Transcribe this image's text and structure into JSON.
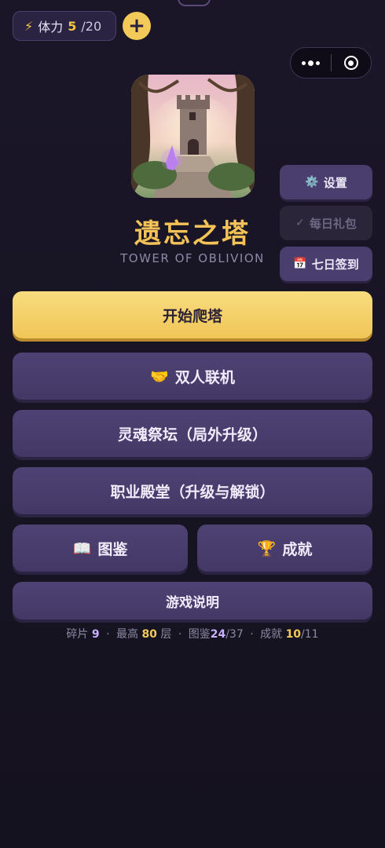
{
  "stamina": {
    "icon": "⚡",
    "label": "体力",
    "current": "5",
    "max": "/20"
  },
  "add_button": {
    "label": "+"
  },
  "game": {
    "title": "遗忘之塔",
    "subtitle": "TOWER OF OBLIVION"
  },
  "side_menu": {
    "settings": {
      "icon": "⚙️",
      "label": "设置"
    },
    "daily_gift": {
      "icon": "✓",
      "label": "每日礼包"
    },
    "seven_day": {
      "icon": "📅",
      "label": "七日签到"
    }
  },
  "main_menu": {
    "start": "开始爬塔",
    "coop": {
      "icon": "🤝",
      "label": "双人联机"
    },
    "altar": "灵魂祭坛（局外升级）",
    "hall": "职业殿堂（升级与解锁）",
    "codex": {
      "icon": "📖",
      "label": "图鉴"
    },
    "achievements": {
      "icon": "🏆",
      "label": "成就"
    },
    "guide": "游戏说明"
  },
  "stats": {
    "shards_label": "碎片",
    "shards": "9",
    "best_label": "最高",
    "best": "80",
    "best_unit": "层",
    "codex_label": "图鉴",
    "codex": "24",
    "codex_total": "/37",
    "ach_label": "成就",
    "ach": "10",
    "ach_total": "/11",
    "separator": "·"
  },
  "colors": {
    "accent_gold": "#f3c95a",
    "button_purple": "#4a3e6e",
    "background": "#15121f"
  }
}
